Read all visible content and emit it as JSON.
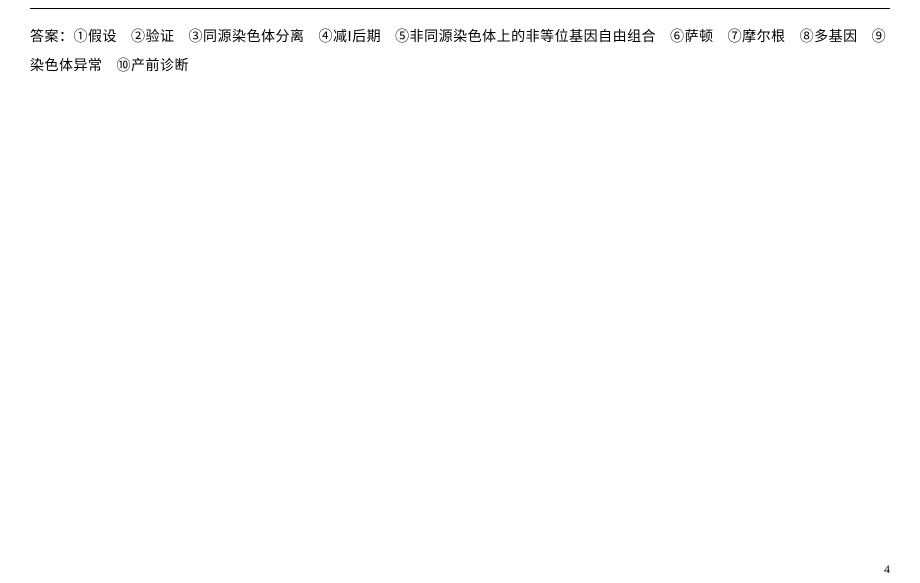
{
  "topLine": true,
  "answerLabel": "答案：",
  "answers": [
    {
      "num": "①",
      "text": "假设"
    },
    {
      "num": "②",
      "text": "验证"
    },
    {
      "num": "③",
      "text": "同源染色体分离"
    },
    {
      "num": "④",
      "text": "减Ⅰ后期"
    },
    {
      "num": "⑤",
      "text": "非同源染色体上的非等位基因自由组合"
    },
    {
      "num": "⑥",
      "text": "萨顿"
    },
    {
      "num": "⑦",
      "text": "摩尔根"
    },
    {
      "num": "⑧",
      "text": "多基因"
    },
    {
      "num": "⑨",
      "text": "染色体异常"
    },
    {
      "num": "⑩",
      "text": "产前诊断"
    }
  ],
  "pageNumber": "4"
}
